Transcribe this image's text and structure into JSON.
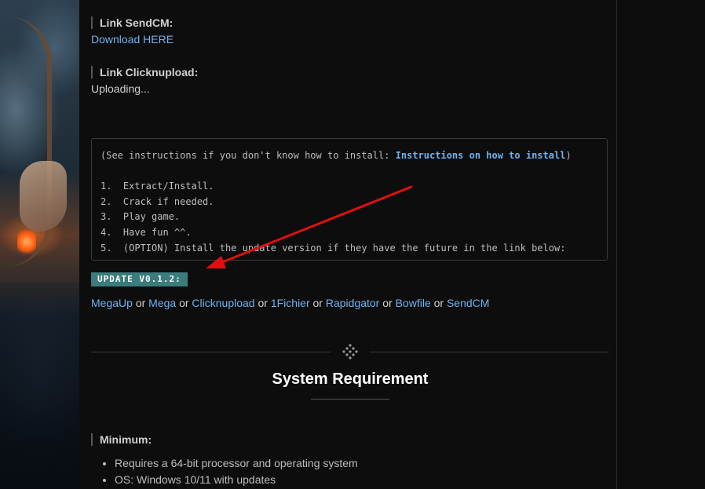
{
  "sendcm": {
    "heading": "Link SendCM:",
    "link_text": "Download HERE"
  },
  "clicknupload": {
    "heading": "Link Clicknupload:",
    "status": "Uploading..."
  },
  "instructions": {
    "prefix": "(See instructions if you don't know how to install: ",
    "link_text": "Instructions on how to install",
    "suffix": ")",
    "steps": [
      "1.  Extract/Install.",
      "2.  Crack if needed.",
      "3.  Play game.",
      "4.  Have fun ^^.",
      "5.  (OPTION) Install the update version if they have the future in the link below:"
    ]
  },
  "update": {
    "badge": "UPDATE V0.1.2:",
    "mirrors": [
      "MegaUp",
      "Mega",
      "Clicknupload",
      "1Fichier",
      "Rapidgator",
      "Bowfile",
      "SendCM"
    ],
    "separator": "or"
  },
  "system": {
    "title": "System Requirement",
    "minimum_heading": "Minimum:",
    "items": [
      "Requires a 64-bit processor and operating system",
      "OS: Windows 10/11 with updates"
    ]
  },
  "colors": {
    "link": "#6fb3f0",
    "badge_bg": "#3b7c7c",
    "arrow": "#e01010",
    "background": "#0d0d0d"
  },
  "icons": {
    "divider": "diamond-dots-icon"
  }
}
